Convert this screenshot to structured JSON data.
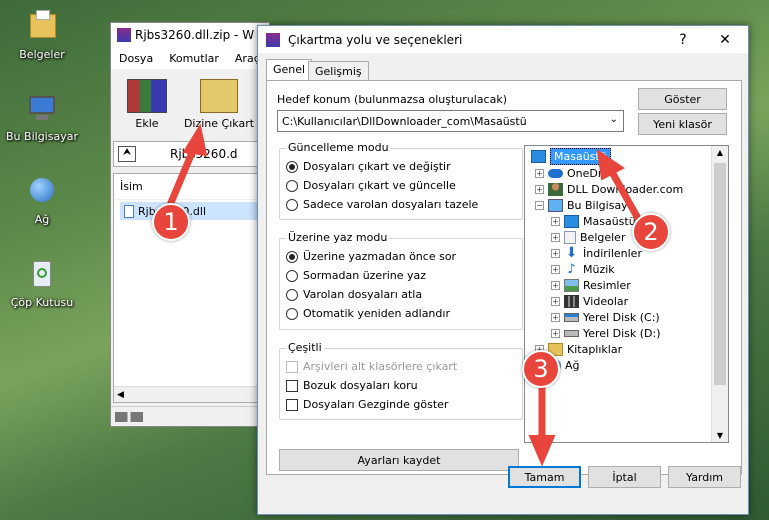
{
  "desktop": {
    "icons": [
      {
        "label": "Belgeler",
        "icon": "folder-icon"
      },
      {
        "label": "Bu Bilgisayar",
        "icon": "computer-icon"
      },
      {
        "label": "Ağ",
        "icon": "network-icon"
      },
      {
        "label": "Çöp Kutusu",
        "icon": "recycle-bin-icon"
      }
    ]
  },
  "winrar": {
    "title": "Rjbs3260.dll.zip - W",
    "menu": [
      "Dosya",
      "Komutlar",
      "Araçla"
    ],
    "toolbar": {
      "add": "Ekle",
      "extract": "Dizine Çıkart"
    },
    "path": "Rjbs3260.d",
    "column_header": "İsim",
    "file": "Rjbs3260.dll"
  },
  "dialog": {
    "title": "Çıkartma yolu ve seçenekleri",
    "help_btn": "?",
    "close_btn": "✕",
    "tabs": [
      "Genel",
      "Gelişmiş"
    ],
    "dest_label": "Hedef konum (bulunmazsa oluşturulacak)",
    "dest_value": "C:\\Kullanıcılar\\DllDownloader_com\\Masaüstü",
    "show_btn": "Göster",
    "new_folder_btn": "Yeni klasör",
    "update_group": {
      "title": "Güncelleme modu",
      "options": [
        "Dosyaları çıkart ve değiştir",
        "Dosyaları çıkart ve güncelle",
        "Sadece varolan dosyaları tazele"
      ],
      "selected": 0
    },
    "overwrite_group": {
      "title": "Üzerine yaz modu",
      "options": [
        "Üzerine yazmadan önce sor",
        "Sormadan üzerine yaz",
        "Varolan dosyaları atla",
        "Otomatik yeniden adlandır"
      ],
      "selected": 0
    },
    "misc_group": {
      "title": "Çeşitli",
      "options": [
        "Arşivleri alt klasörlere çıkart",
        "Bozuk dosyaları koru",
        "Dosyaları Gezginde göster"
      ]
    },
    "save_settings_btn": "Ayarları kaydet",
    "tree": [
      {
        "label": "Masaüstü",
        "level": 0,
        "icon": "desktop-icon",
        "selected": true
      },
      {
        "label": "OneDr",
        "level": 1,
        "icon": "onedrive-icon"
      },
      {
        "label": "DLL Downloader.com",
        "level": 1,
        "icon": "user-icon"
      },
      {
        "label": "Bu Bilgisaya",
        "level": 1,
        "icon": "computer-icon"
      },
      {
        "label": "Masaüstü",
        "level": 2,
        "icon": "desktop-icon"
      },
      {
        "label": "Belgeler",
        "level": 2,
        "icon": "documents-icon"
      },
      {
        "label": "İndirilenler",
        "level": 2,
        "icon": "downloads-icon"
      },
      {
        "label": "Müzik",
        "level": 2,
        "icon": "music-icon"
      },
      {
        "label": "Resimler",
        "level": 2,
        "icon": "pictures-icon"
      },
      {
        "label": "Videolar",
        "level": 2,
        "icon": "videos-icon"
      },
      {
        "label": "Yerel Disk (C:)",
        "level": 2,
        "icon": "disk-icon"
      },
      {
        "label": "Yerel Disk (D:)",
        "level": 2,
        "icon": "disk-icon"
      },
      {
        "label": "Kitaplıklar",
        "level": 1,
        "icon": "libraries-icon"
      },
      {
        "label": "Ağ",
        "level": 1,
        "icon": "network-icon"
      }
    ],
    "ok_btn": "Tamam",
    "cancel_btn": "İptal",
    "help_btn_label": "Yardım"
  },
  "callouts": [
    "1",
    "2",
    "3"
  ],
  "colors": {
    "accent": "#0078d7",
    "callout": "#e8463c",
    "selection": "#3399ff"
  }
}
